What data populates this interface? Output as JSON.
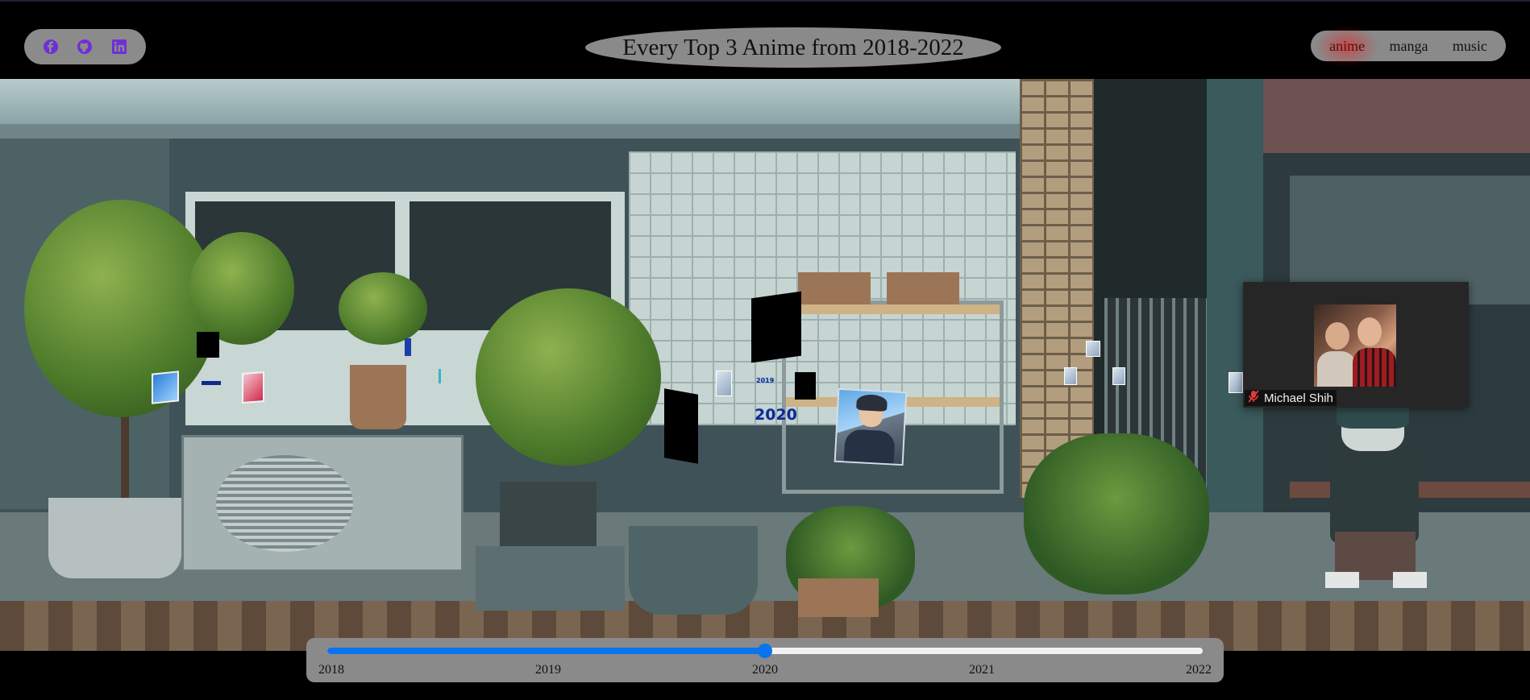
{
  "header": {
    "title": "Every Top 3 Anime from 2018-2022",
    "social": [
      {
        "name": "facebook-icon",
        "color": "#6f2fd6"
      },
      {
        "name": "github-icon",
        "color": "#6f2fd6"
      },
      {
        "name": "linkedin-icon",
        "color": "#6f2fd6"
      }
    ],
    "nav": [
      {
        "label": "anime",
        "active": true
      },
      {
        "label": "manga",
        "active": false
      },
      {
        "label": "music",
        "active": false
      }
    ],
    "active_glow_color": "#ff0000"
  },
  "scene": {
    "floating_year_labels": [
      "2019",
      "2020"
    ],
    "posters": [
      {
        "icon": "anime-poster-thumbnail"
      }
    ]
  },
  "video_call": {
    "participant_name": "Michael Shih",
    "mic_status_icon": "mic-muted-icon",
    "mic_muted": true
  },
  "timeline": {
    "ticks": [
      "2018",
      "2019",
      "2020",
      "2021",
      "2022"
    ],
    "selected": "2020",
    "progress_fraction": 0.5,
    "accent_color": "#0a74f0"
  }
}
